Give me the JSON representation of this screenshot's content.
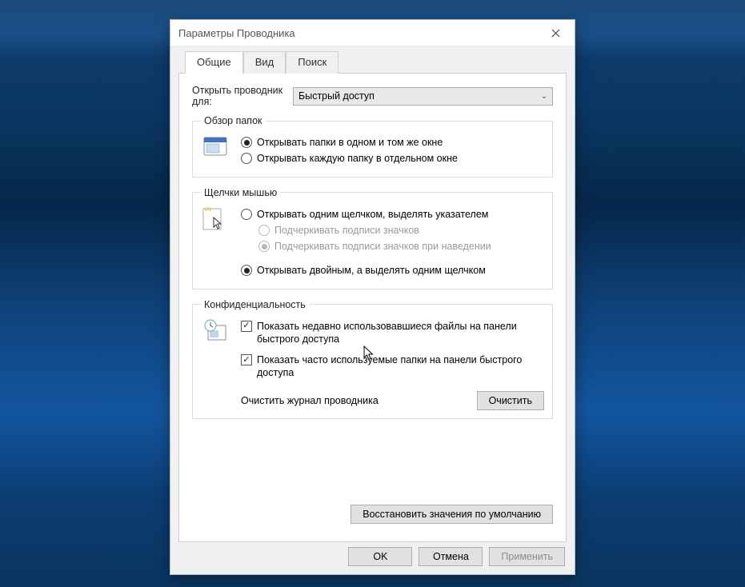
{
  "window": {
    "title": "Параметры Проводника"
  },
  "tabs": [
    "Общие",
    "Вид",
    "Поиск"
  ],
  "open_for": {
    "label": "Открыть проводник для:",
    "selected": "Быстрый доступ"
  },
  "groups": {
    "browse": {
      "legend": "Обзор папок",
      "opt_same": "Открывать папки в одном и том же окне",
      "opt_sep": "Открывать каждую папку в отдельном окне"
    },
    "click": {
      "legend": "Щелчки мышью",
      "opt_single": "Открывать одним щелчком, выделять указателем",
      "sub_underline": "Подчеркивать подписи значков",
      "sub_underline_hover": "Подчеркивать подписи значков при наведении",
      "opt_double": "Открывать двойным, а выделять одним щелчком"
    },
    "privacy": {
      "legend": "Конфиденциальность",
      "chk_recent": "Показать недавно использовавшиеся файлы на панели быстрого доступа",
      "chk_freq": "Показать часто используемые папки на панели быстрого доступа",
      "clear_label": "Очистить журнал проводника",
      "clear_btn": "Очистить"
    }
  },
  "restore_defaults": "Восстановить значения по умолчанию",
  "footer": {
    "ok": "OK",
    "cancel": "Отмена",
    "apply": "Применить"
  }
}
